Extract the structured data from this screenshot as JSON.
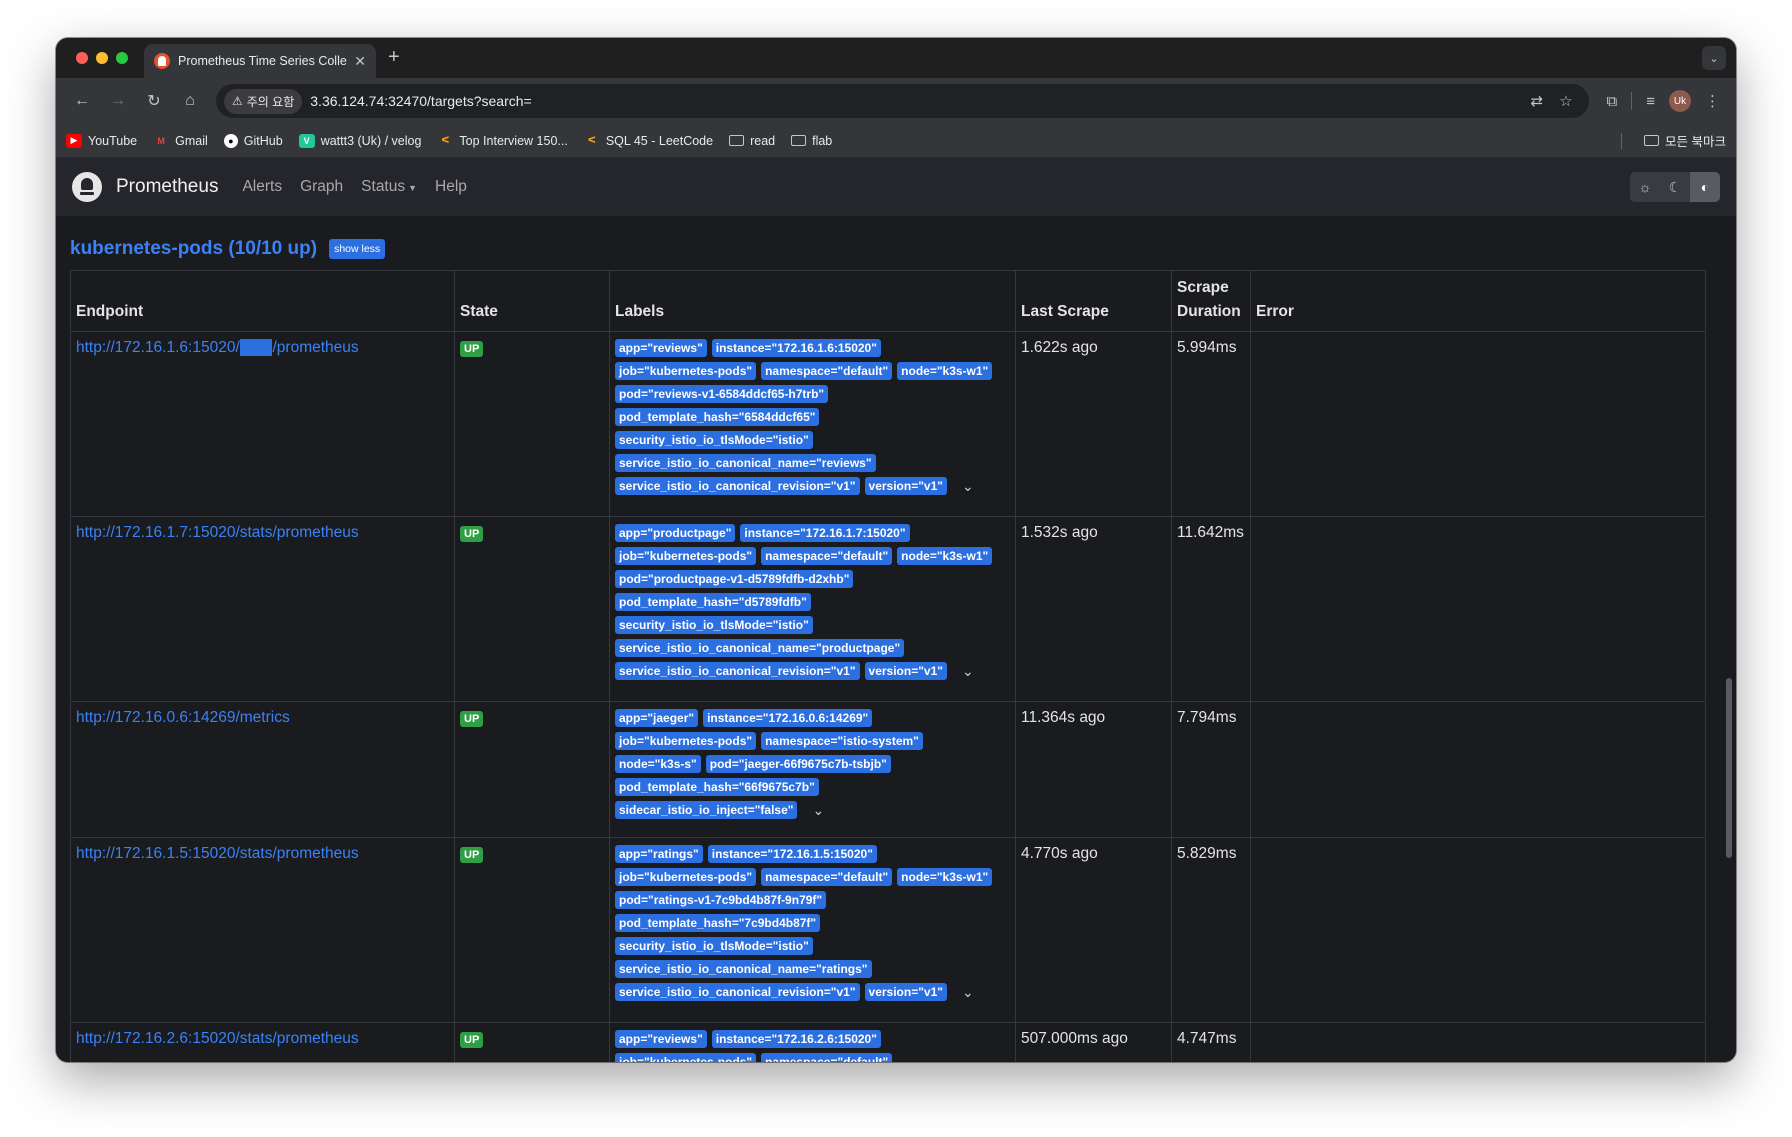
{
  "browser": {
    "tab_title": "Prometheus Time Series Colle",
    "warning_chip": "주의 요함",
    "url": "3.36.124.74:32470/targets?search=",
    "avatar_initials": "Uk",
    "bookmarks": [
      {
        "label": "YouTube",
        "icon": "youtube-icon",
        "color": "#ff0000"
      },
      {
        "label": "Gmail",
        "icon": "gmail-icon",
        "color": "#ea4335"
      },
      {
        "label": "GitHub",
        "icon": "github-icon",
        "color": "#ffffff"
      },
      {
        "label": "wattt3 (Uk) / velog",
        "icon": "velog-icon",
        "color": "#20c997"
      },
      {
        "label": "Top Interview 150...",
        "icon": "leetcode-icon",
        "color": "#ffa116"
      },
      {
        "label": "SQL 45 - LeetCode",
        "icon": "leetcode-icon",
        "color": "#ffa116"
      },
      {
        "label": "read",
        "icon": "folder-icon"
      },
      {
        "label": "flab",
        "icon": "folder-icon"
      }
    ],
    "all_bookmarks": "모든 북마크"
  },
  "nav": {
    "brand": "Prometheus",
    "alerts": "Alerts",
    "graph": "Graph",
    "status": "Status",
    "help": "Help"
  },
  "pool": {
    "title": "kubernetes-pods (10/10 up)",
    "show_less": "show less"
  },
  "columns": {
    "endpoint": "Endpoint",
    "state": "State",
    "labels": "Labels",
    "last_scrape": "Last Scrape",
    "scrape_duration_1": "Scrape",
    "scrape_duration_2": "Duration",
    "error": "Error"
  },
  "rows": [
    {
      "endpoint_pre": "http://172.16.1.6:15020/",
      "endpoint_hl": "stats",
      "endpoint_post": "/prometheus",
      "state": "UP",
      "labels": [
        "app=\"reviews\"",
        "instance=\"172.16.1.6:15020\"",
        "job=\"kubernetes-pods\"",
        "namespace=\"default\"",
        "node=\"k3s-w1\"",
        "pod=\"reviews-v1-6584ddcf65-h7trb\"",
        "pod_template_hash=\"6584ddcf65\"",
        "security_istio_io_tlsMode=\"istio\"",
        "service_istio_io_canonical_name=\"reviews\"",
        "service_istio_io_canonical_revision=\"v1\"",
        "version=\"v1\""
      ],
      "last_scrape": "1.622s ago",
      "duration": "5.994ms",
      "error": ""
    },
    {
      "endpoint_pre": "http://172.16.1.7:15020/stats/prometheus",
      "endpoint_hl": "",
      "endpoint_post": "",
      "state": "UP",
      "labels": [
        "app=\"productpage\"",
        "instance=\"172.16.1.7:15020\"",
        "job=\"kubernetes-pods\"",
        "namespace=\"default\"",
        "node=\"k3s-w1\"",
        "pod=\"productpage-v1-d5789fdfb-d2xhb\"",
        "pod_template_hash=\"d5789fdfb\"",
        "security_istio_io_tlsMode=\"istio\"",
        "service_istio_io_canonical_name=\"productpage\"",
        "service_istio_io_canonical_revision=\"v1\"",
        "version=\"v1\""
      ],
      "last_scrape": "1.532s ago",
      "duration": "11.642ms",
      "error": ""
    },
    {
      "endpoint_pre": "http://172.16.0.6:14269/metrics",
      "endpoint_hl": "",
      "endpoint_post": "",
      "state": "UP",
      "labels": [
        "app=\"jaeger\"",
        "instance=\"172.16.0.6:14269\"",
        "job=\"kubernetes-pods\"",
        "namespace=\"istio-system\"",
        "node=\"k3s-s\"",
        "pod=\"jaeger-66f9675c7b-tsbjb\"",
        "pod_template_hash=\"66f9675c7b\"",
        "sidecar_istio_io_inject=\"false\""
      ],
      "last_scrape": "11.364s ago",
      "duration": "7.794ms",
      "error": ""
    },
    {
      "endpoint_pre": "http://172.16.1.5:15020/stats/prometheus",
      "endpoint_hl": "",
      "endpoint_post": "",
      "state": "UP",
      "labels": [
        "app=\"ratings\"",
        "instance=\"172.16.1.5:15020\"",
        "job=\"kubernetes-pods\"",
        "namespace=\"default\"",
        "node=\"k3s-w1\"",
        "pod=\"ratings-v1-7c9bd4b87f-9n79f\"",
        "pod_template_hash=\"7c9bd4b87f\"",
        "security_istio_io_tlsMode=\"istio\"",
        "service_istio_io_canonical_name=\"ratings\"",
        "service_istio_io_canonical_revision=\"v1\"",
        "version=\"v1\""
      ],
      "last_scrape": "4.770s ago",
      "duration": "5.829ms",
      "error": ""
    },
    {
      "endpoint_pre": "http://172.16.2.6:15020/stats/prometheus",
      "endpoint_hl": "",
      "endpoint_post": "",
      "state": "UP",
      "labels": [
        "app=\"reviews\"",
        "instance=\"172.16.2.6:15020\"",
        "job=\"kubernetes-pods\"",
        "namespace=\"default\""
      ],
      "last_scrape": "507.000ms ago",
      "duration": "4.747ms",
      "error": ""
    }
  ]
}
